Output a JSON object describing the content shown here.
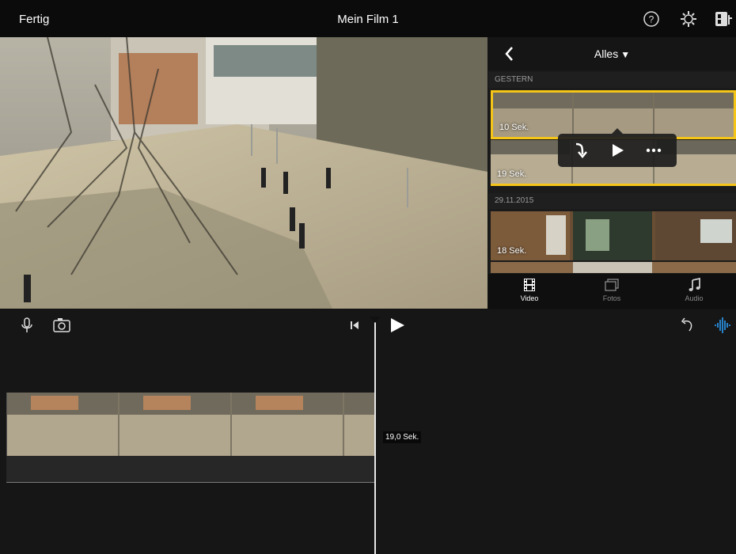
{
  "topbar": {
    "done_label": "Fertig",
    "title": "Mein Film 1",
    "help_icon": "question-circle-icon",
    "settings_icon": "gear-icon",
    "project_icon": "project-settings-icon"
  },
  "browser": {
    "filter_label": "Alles",
    "sections": [
      {
        "label": "GESTERN",
        "clips": [
          {
            "duration": "10 Sek.",
            "selected": true
          },
          {
            "duration": "19 Sek.",
            "selected": false
          }
        ]
      },
      {
        "label": "29.11.2015",
        "clips": [
          {
            "duration": "18 Sek.",
            "selected": false
          }
        ]
      }
    ],
    "tabs": [
      {
        "label": "Video",
        "icon": "filmstrip-icon",
        "active": true
      },
      {
        "label": "Fotos",
        "icon": "photos-icon",
        "active": false
      },
      {
        "label": "Audio",
        "icon": "music-note-icon",
        "active": false
      }
    ],
    "popover_actions": [
      "add-to-timeline-icon",
      "play-icon",
      "more-icon"
    ]
  },
  "timeline": {
    "duration_label": "19,0 Sek.",
    "icons": [
      "microphone-icon",
      "camera-icon",
      "skip-to-start-icon",
      "play-icon",
      "undo-icon",
      "audio-waveform-icon"
    ]
  },
  "colors": {
    "accent_yellow": "#f5c518",
    "waveform_blue": "#2a9df4"
  }
}
